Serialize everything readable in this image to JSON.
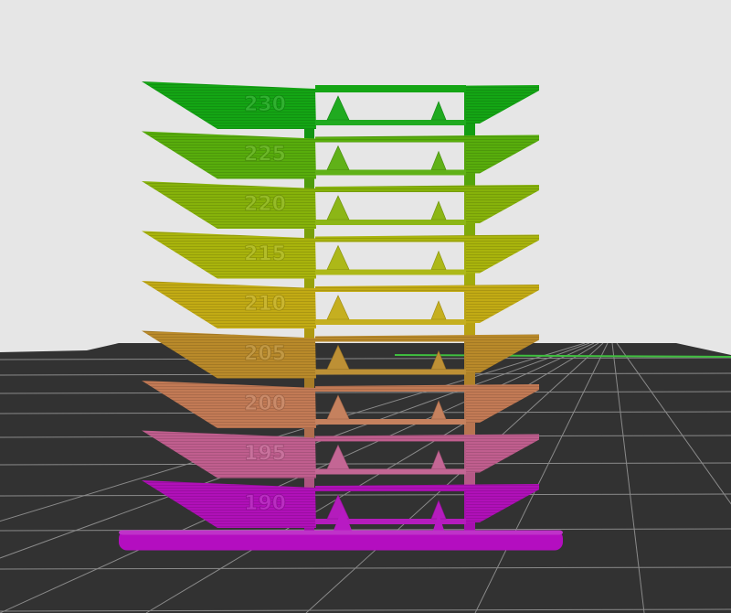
{
  "scene": {
    "background_color": "#e6e6e6",
    "bed_color": "#323232",
    "grid_color": "#8a8a8a",
    "bed_edge_accent": "#3fbf3f"
  },
  "model": {
    "name": "temperature tower",
    "tiers": [
      {
        "label": "230",
        "color": "#14a514"
      },
      {
        "label": "225",
        "color": "#58ad0c"
      },
      {
        "label": "220",
        "color": "#86b20a"
      },
      {
        "label": "215",
        "color": "#a9b40c"
      },
      {
        "label": "210",
        "color": "#c2ab14"
      },
      {
        "label": "205",
        "color": "#b98a2a"
      },
      {
        "label": "200",
        "color": "#c27a55"
      },
      {
        "label": "195",
        "color": "#c05e8e"
      },
      {
        "label": "190",
        "color": "#b010b8"
      }
    ],
    "base_color": "#b40ec0"
  }
}
